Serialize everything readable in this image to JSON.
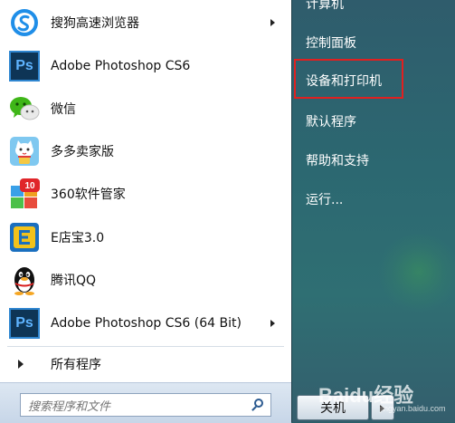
{
  "left_items": [
    {
      "label": "搜狗高速浏览器",
      "icon": "sogou-browser-icon",
      "has_submenu": true
    },
    {
      "label": "Adobe Photoshop CS6",
      "icon": "photoshop-icon",
      "icon_text": "Ps",
      "has_submenu": false
    },
    {
      "label": "微信",
      "icon": "wechat-icon",
      "has_submenu": false
    },
    {
      "label": "多多卖家版",
      "icon": "lucky-cat-icon",
      "has_submenu": false
    },
    {
      "label": "360软件管家",
      "icon": "360-software-manager-icon",
      "badge": "10",
      "has_submenu": false
    },
    {
      "label": "E店宝3.0",
      "icon": "edianbao-icon",
      "icon_text": "E",
      "has_submenu": false
    },
    {
      "label": "腾讯QQ",
      "icon": "qq-penguin-icon",
      "has_submenu": false
    },
    {
      "label": "Adobe Photoshop CS6 (64 Bit)",
      "icon": "photoshop-icon",
      "icon_text": "Ps",
      "has_submenu": true
    }
  ],
  "all_programs_label": "所有程序",
  "search": {
    "placeholder": "搜索程序和文件"
  },
  "right_items": [
    {
      "label": "计算机"
    },
    {
      "label": "控制面板"
    },
    {
      "label": "设备和打印机",
      "highlighted": true
    },
    {
      "label": "默认程序"
    },
    {
      "label": "帮助和支持"
    },
    {
      "label": "运行..."
    }
  ],
  "shutdown_label": "关机",
  "watermark": {
    "text": "Baidu经验",
    "sub": "jingyan.baidu.com"
  },
  "colors": {
    "highlight_border": "#e02020",
    "right_panel": "#2c6871"
  }
}
